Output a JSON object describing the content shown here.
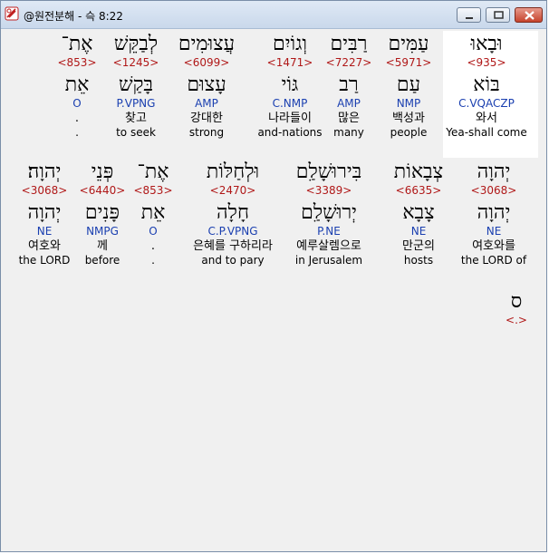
{
  "window": {
    "title": "@원전분해 - 슥 8:22"
  },
  "lines": [
    [
      {
        "hebrew": "וּבָאוּ",
        "strong": "<935>",
        "root": "בּוֹא",
        "parse": "C.VQACZP",
        "korean": "와서",
        "english": "Yea-shall come"
      },
      {
        "hebrew": "עַמִּים",
        "strong": "<5971>",
        "root": "עַם",
        "parse": "NMP",
        "korean": "백성과",
        "english": "people"
      },
      {
        "hebrew": "רַבִּים",
        "strong": "<7227>",
        "root": "רַב",
        "parse": "AMP",
        "korean": "많은",
        "english": "many"
      },
      {
        "hebrew": "וְגוֹיִם",
        "strong": "<1471>",
        "root": "גּוֹי",
        "parse": "C.NMP",
        "korean": "나라들이",
        "english": "and-nations"
      },
      {
        "hebrew": "עֲצוּמִים",
        "strong": "<6099>",
        "root": "עָצוּם",
        "parse": "AMP",
        "korean": "강대한",
        "english": "strong"
      },
      {
        "hebrew": "לְבַקֵּשׁ",
        "strong": "<1245>",
        "root": "בָּקַשׁ",
        "parse": "P.VPNG",
        "korean": "찾고",
        "english": "to seek"
      },
      {
        "hebrew": "אֶת־",
        "strong": "<853>",
        "root": "אֵת",
        "parse": "O",
        "korean": ".",
        "english": "."
      }
    ],
    [
      {
        "hebrew": "יְהוָה",
        "strong": "<3068>",
        "root": "יְהוָה",
        "parse": "NE",
        "korean": "여호와를",
        "english": "the LORD of"
      },
      {
        "hebrew": "צְבָאוֹת",
        "strong": "<6635>",
        "root": "צָבָא",
        "parse": "NE",
        "korean": "만군의",
        "english": "hosts"
      },
      {
        "hebrew": "בִּירוּשָׁלִַם",
        "strong": "<3389>",
        "root": "יְרוּשָׁלִַם",
        "parse": "P.NE",
        "korean": "예루살렘으로",
        "english": "in Jerusalem"
      },
      {
        "hebrew": "וּלְחַלּוֹת",
        "strong": "<2470>",
        "root": "חָלָה",
        "parse": "C.P.VPNG",
        "korean": "은혜를 구하리라",
        "english": "and to pary"
      },
      {
        "hebrew": "אֶת־",
        "strong": "<853>",
        "root": "אֵת",
        "parse": "O",
        "korean": ".",
        "english": "."
      },
      {
        "hebrew": "פְּנֵי",
        "strong": "<6440>",
        "root": "פָּנִים",
        "parse": "NMPG",
        "korean": "께",
        "english": "before"
      },
      {
        "hebrew": "יְהוָה׃",
        "strong": "<3068>",
        "root": "יְהוָה",
        "parse": "NE",
        "korean": "여호와",
        "english": "the LORD"
      }
    ],
    [
      {
        "hebrew": "ס",
        "strong": "<.>"
      }
    ]
  ]
}
